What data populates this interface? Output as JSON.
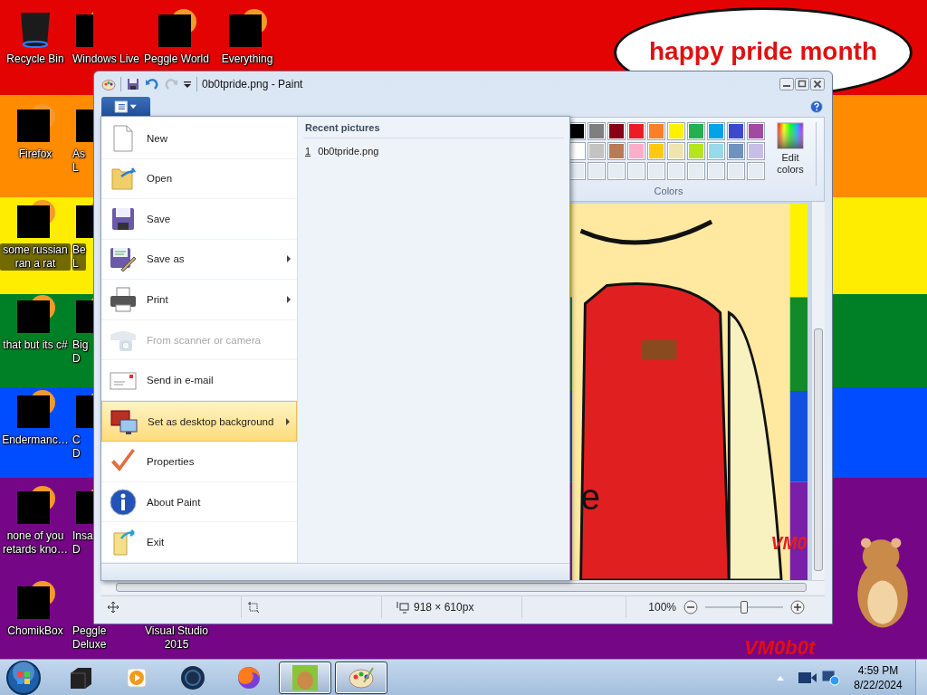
{
  "desktop": {
    "bubble_text": "happy pride month",
    "signature": "VM0b0t",
    "icon_columns": [
      {
        "icons": [
          {
            "label": "Recycle Bin",
            "kind": "bin"
          },
          {
            "label": "Firefox",
            "kind": "redacted"
          },
          {
            "label": "some russian ran a rat",
            "kind": "redacted"
          },
          {
            "label": "that but its c#",
            "kind": "redacted"
          },
          {
            "label": "Endermanc…",
            "kind": "redacted"
          },
          {
            "label": "none of you retards kno…",
            "kind": "redacted"
          },
          {
            "label": "ChomikBox",
            "kind": "redacted"
          }
        ]
      },
      {
        "icons": [
          {
            "label": "Windows Live",
            "kind": "redacted"
          },
          {
            "label": "As\nL",
            "kind": "redacted"
          },
          {
            "label": "Be\nL",
            "kind": "redacted"
          },
          {
            "label": "Big\nD",
            "kind": "redacted"
          },
          {
            "label": "C\nD",
            "kind": "redacted"
          },
          {
            "label": "Insa\nD",
            "kind": "redacted"
          },
          {
            "label": "Peggle Deluxe",
            "kind": "hidden"
          }
        ]
      },
      {
        "icons": [
          {
            "label": "Peggle World",
            "kind": "redacted"
          },
          {
            "label": "Visual Studio 2015",
            "kind": "hidden"
          }
        ]
      },
      {
        "icons": [
          {
            "label": "Everything",
            "kind": "redacted"
          }
        ]
      }
    ]
  },
  "paint_window": {
    "title": "0b0tpride.png - Paint",
    "colors": {
      "label": "Colors",
      "edit_label": "Edit colors",
      "swatches": [
        {
          "kind": "color",
          "color": "#000000"
        },
        {
          "kind": "color",
          "color": "#7f7f7f"
        },
        {
          "kind": "color",
          "color": "#880015"
        },
        {
          "kind": "color",
          "color": "#ed1c24"
        },
        {
          "kind": "color",
          "color": "#ff7f27"
        },
        {
          "kind": "color",
          "color": "#fff200"
        },
        {
          "kind": "color",
          "color": "#22b14c"
        },
        {
          "kind": "color",
          "color": "#00a2e8"
        },
        {
          "kind": "color",
          "color": "#3f48cc"
        },
        {
          "kind": "color",
          "color": "#a349a4"
        },
        {
          "kind": "color",
          "color": "#ffffff"
        },
        {
          "kind": "color",
          "color": "#c3c3c3"
        },
        {
          "kind": "color",
          "color": "#b97a57"
        },
        {
          "kind": "color",
          "color": "#ffaec9"
        },
        {
          "kind": "color",
          "color": "#ffc90e"
        },
        {
          "kind": "color",
          "color": "#efe4b0"
        },
        {
          "kind": "color",
          "color": "#b5e61d"
        },
        {
          "kind": "color",
          "color": "#99d9ea"
        },
        {
          "kind": "color",
          "color": "#7092be"
        },
        {
          "kind": "color",
          "color": "#c8bfe7"
        },
        {
          "kind": "empty"
        },
        {
          "kind": "empty"
        },
        {
          "kind": "empty"
        },
        {
          "kind": "empty"
        },
        {
          "kind": "empty"
        },
        {
          "kind": "empty"
        },
        {
          "kind": "empty"
        },
        {
          "kind": "empty"
        },
        {
          "kind": "empty"
        },
        {
          "kind": "empty"
        }
      ]
    },
    "canvas_texts": [
      "e",
      "VM0"
    ],
    "file_menu": {
      "items": [
        {
          "label": "New",
          "kind": "new",
          "submenu": false,
          "disabled": false,
          "selected": false
        },
        {
          "label": "Open",
          "kind": "open",
          "submenu": false,
          "disabled": false,
          "selected": false
        },
        {
          "label": "Save",
          "kind": "save",
          "submenu": false,
          "disabled": false,
          "selected": false
        },
        {
          "label": "Save as",
          "kind": "saveas",
          "submenu": true,
          "disabled": false,
          "selected": false
        },
        {
          "label": "Print",
          "kind": "print",
          "submenu": true,
          "disabled": false,
          "selected": false
        },
        {
          "label": "From scanner or camera",
          "kind": "scanner",
          "submenu": false,
          "disabled": true,
          "selected": false
        },
        {
          "label": "Send in e-mail",
          "kind": "email",
          "submenu": false,
          "disabled": false,
          "selected": false
        },
        {
          "label": "Set as desktop background",
          "kind": "desktop",
          "submenu": true,
          "disabled": false,
          "selected": true
        },
        {
          "label": "Properties",
          "kind": "properties",
          "submenu": false,
          "disabled": false,
          "selected": false
        },
        {
          "label": "About Paint",
          "kind": "about",
          "submenu": false,
          "disabled": false,
          "selected": false
        },
        {
          "label": "Exit",
          "kind": "exit",
          "submenu": false,
          "disabled": false,
          "selected": false
        }
      ],
      "recent_title": "Recent pictures",
      "recent": [
        {
          "number": "1",
          "name": "0b0tpride.png"
        }
      ]
    },
    "status": {
      "image_size": "918 × 610px",
      "zoom": "100%",
      "zoom_level": {
        "level": 0.5
      }
    }
  },
  "taskbar": {
    "buttons": [
      {
        "kind": "box",
        "active": false
      },
      {
        "kind": "media",
        "active": false
      },
      {
        "kind": "globe",
        "active": false
      },
      {
        "kind": "firefox",
        "active": false
      },
      {
        "kind": "hamster",
        "active": true
      },
      {
        "kind": "paint",
        "active": true
      }
    ],
    "clock": {
      "time": "4:59 PM",
      "date": "8/22/2024"
    }
  }
}
